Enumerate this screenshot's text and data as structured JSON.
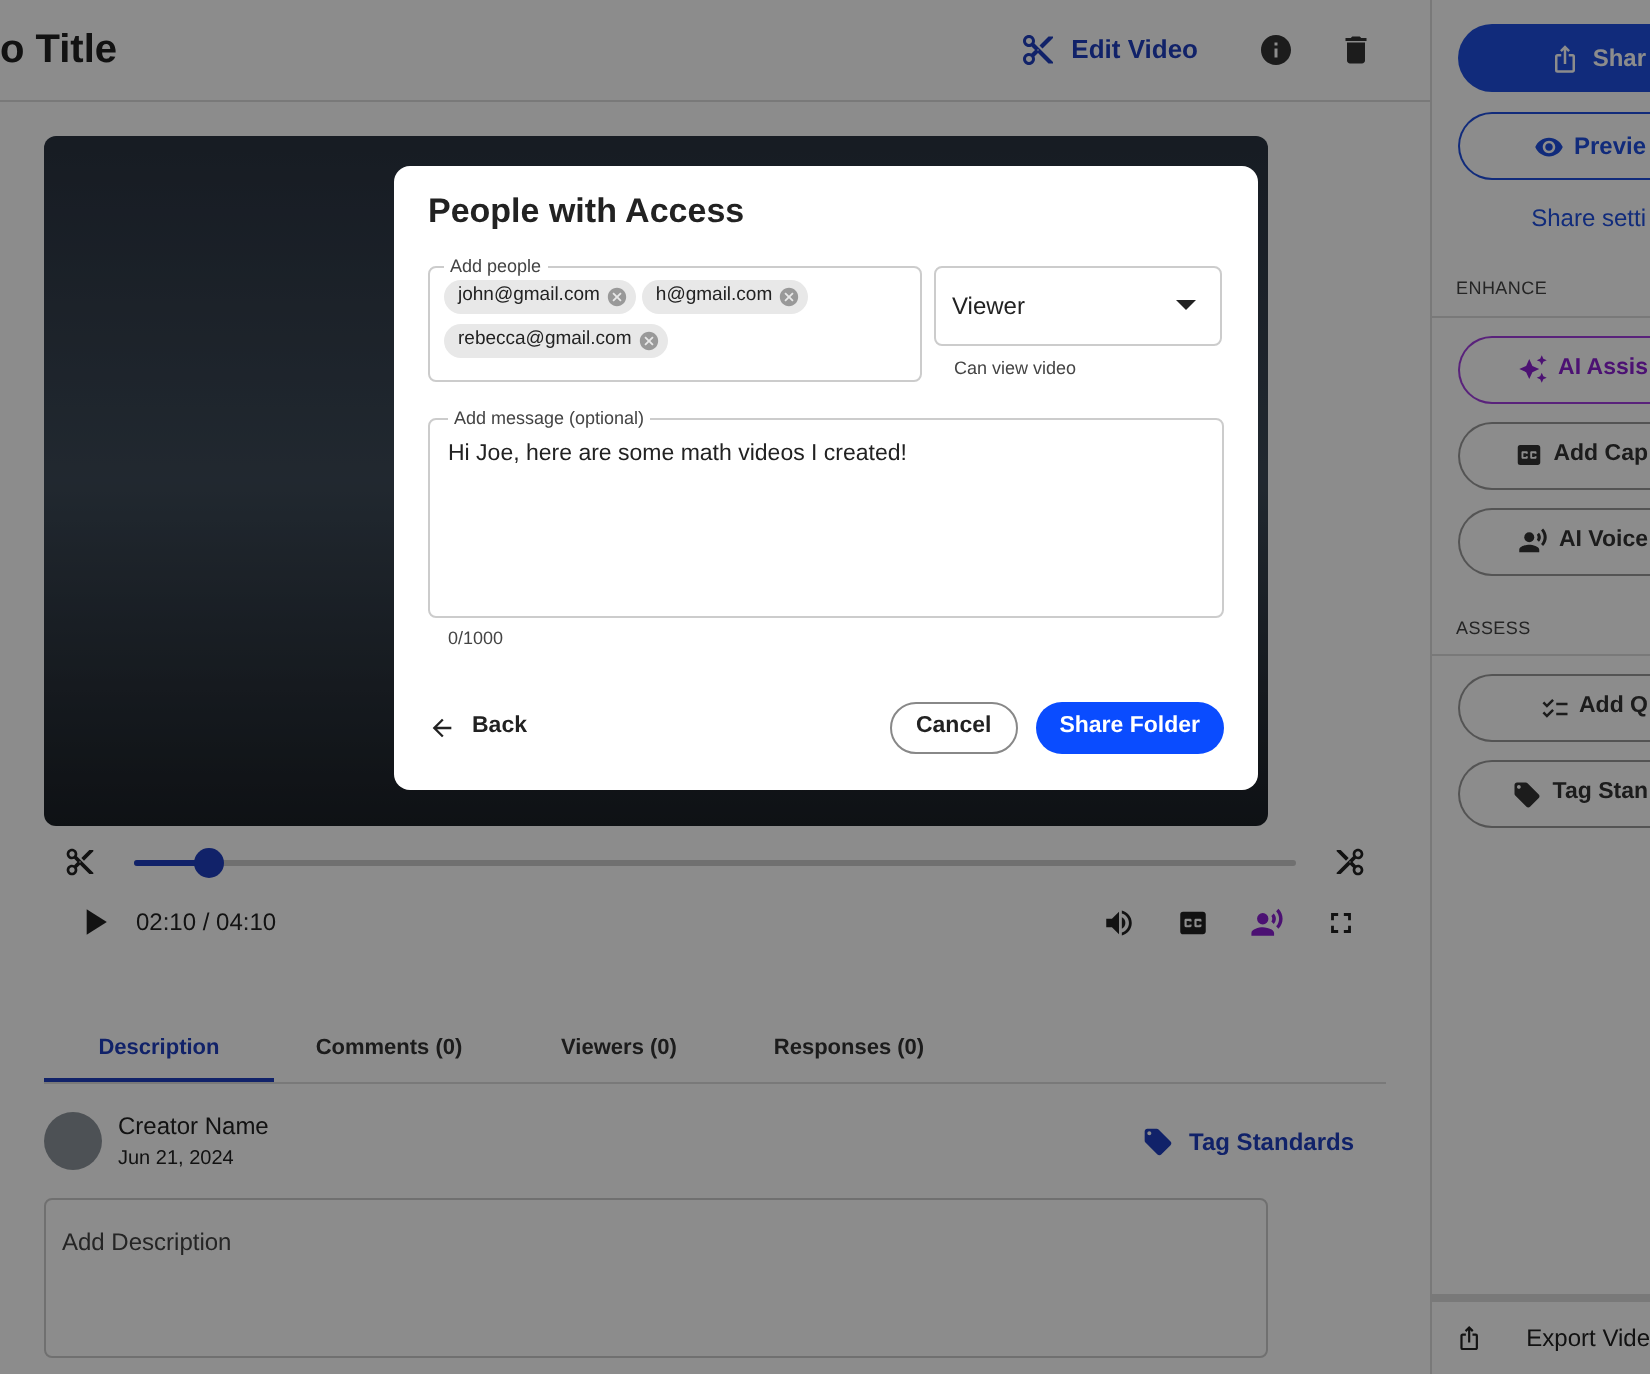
{
  "header": {
    "title": "o Title",
    "edit_button": "Edit Video"
  },
  "player": {
    "level": 0.063,
    "time": "02:10 / 04:10"
  },
  "tabs": [
    {
      "label": "Description",
      "selected": true
    },
    {
      "label": "Comments (0)",
      "selected": false
    },
    {
      "label": "Viewers (0)",
      "selected": false
    },
    {
      "label": "Responses (0)",
      "selected": false
    }
  ],
  "creator": {
    "name": "Creator Name",
    "date": "Jun 21, 2024"
  },
  "tag_button": "Tag Standards",
  "description": {
    "placeholder": "Add Description"
  },
  "sidebar": {
    "share_button": "Shar",
    "preview_button": "Previe",
    "settings_link": "Share setti",
    "sections": [
      {
        "label": "ENHANCE",
        "items": [
          {
            "kind": "ai",
            "label": "AI Assis"
          },
          {
            "kind": "captions",
            "label": "Add Cap"
          },
          {
            "kind": "voice",
            "label": "AI Voice"
          }
        ]
      },
      {
        "label": "ASSESS",
        "items": [
          {
            "kind": "quiz",
            "label": "Add Q"
          },
          {
            "kind": "tag",
            "label": "Tag Stan"
          }
        ]
      }
    ],
    "export": "Export Vide"
  },
  "dialog": {
    "title": "People with Access",
    "people_label": "Add people",
    "people": [
      "john@gmail.com",
      "h@gmail.com",
      "rebecca@gmail.com"
    ],
    "role": "Viewer",
    "role_hint": "Can view video",
    "message_label": "Add message (optional)",
    "message": "Hi Joe, here are some math videos I created!",
    "counter": "0/1000",
    "back": "Back",
    "cancel": "Cancel",
    "submit": "Share Folder"
  }
}
